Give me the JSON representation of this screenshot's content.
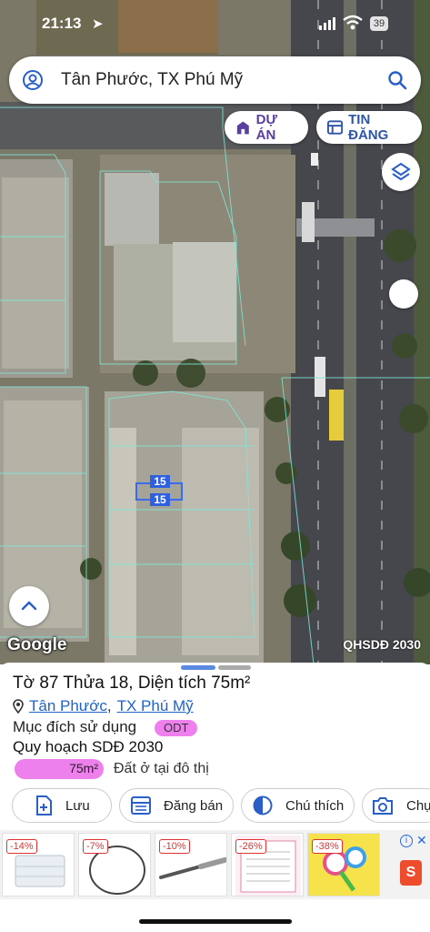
{
  "status": {
    "time": "21:13",
    "battery": "39"
  },
  "search": {
    "query": "Tân Phước, TX Phú Mỹ"
  },
  "chips": {
    "du_an": "DỰ ÁN",
    "tin_dang": "TIN ĐĂNG"
  },
  "map": {
    "parcel_label_top": "15",
    "parcel_label_bottom": "15",
    "attribution": "Google",
    "layer_tag": "QHSDĐ 2030"
  },
  "parcel": {
    "title": "Tờ 87 Thửa 18, Diện tích 75m²",
    "ward": "Tân Phước",
    "separator": ",",
    "town": "TX Phú Mỹ",
    "purpose_label": "Mục đích sử dụng",
    "purpose_code": "ODT",
    "plan_label": "Quy hoạch SDĐ 2030",
    "plan_area": "75m²",
    "plan_desc": "Đất ở tại đô thị"
  },
  "actions": {
    "save": "Lưu",
    "post": "Đăng bán",
    "legend": "Chú thích",
    "capture": "Chụ"
  },
  "ads": [
    {
      "discount": "-14%"
    },
    {
      "discount": "-7%"
    },
    {
      "discount": "-10%"
    },
    {
      "discount": "-26%"
    },
    {
      "discount": "-38%"
    }
  ],
  "colors": {
    "accent_blue": "#2d55a8",
    "plan_pink": "#ee80ee",
    "link_blue": "#1e64c8",
    "parcel_line": "#7fe6d8"
  }
}
